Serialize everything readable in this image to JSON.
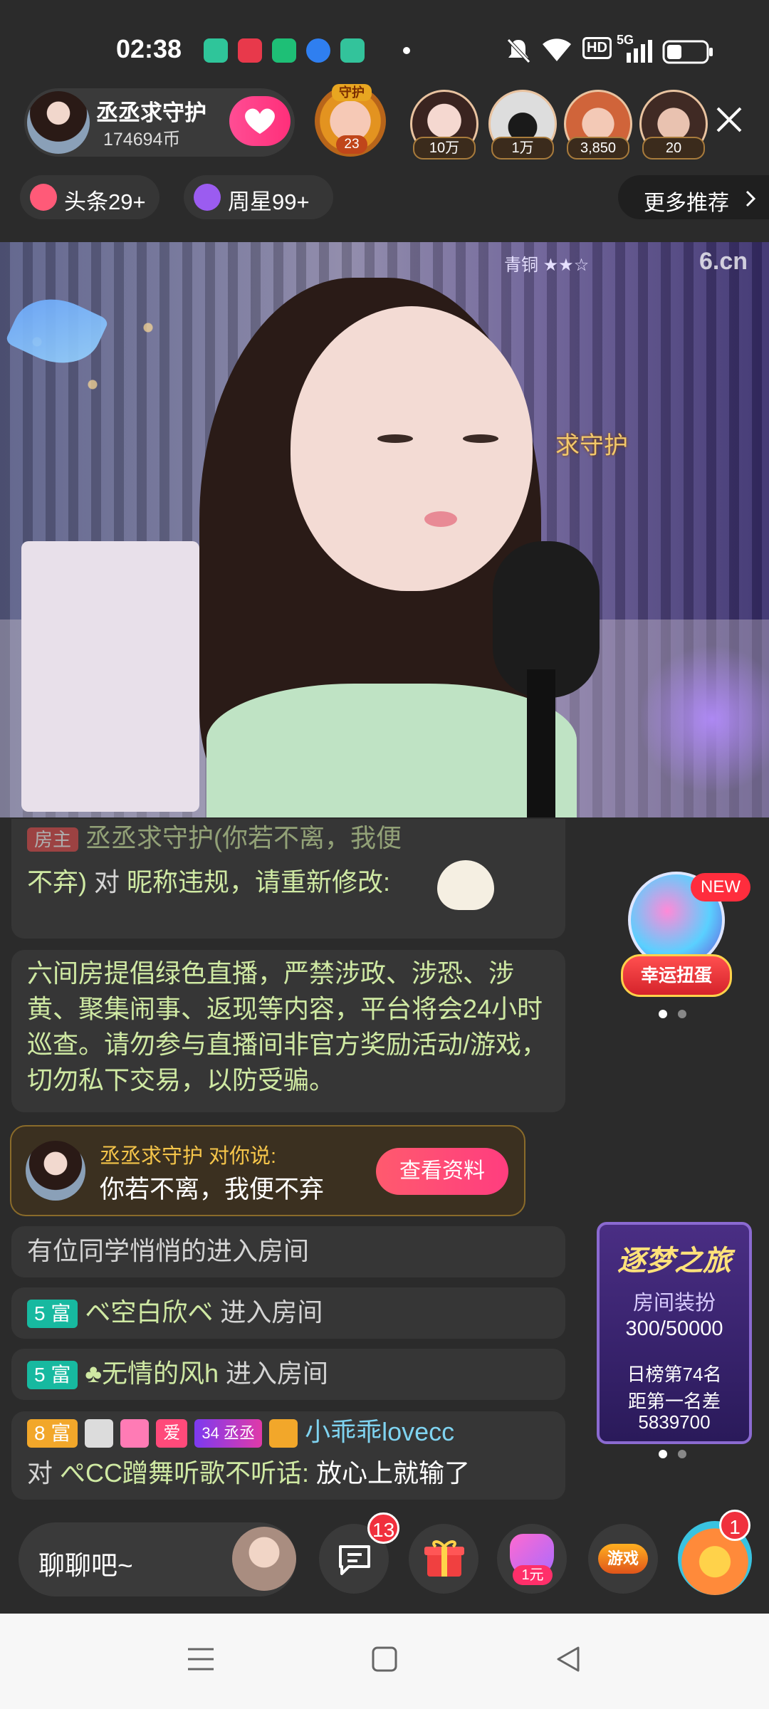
{
  "status_bar": {
    "time": "02:38",
    "network": "5G",
    "hd": "HD"
  },
  "header": {
    "anchor_name": "丞丞求守护",
    "anchor_coins": "174694币",
    "guard_label": "守护",
    "guard_count": "23",
    "viewers": [
      {
        "count": "10万"
      },
      {
        "count": "1万"
      },
      {
        "count": "3,850"
      },
      {
        "count": "20"
      }
    ]
  },
  "chips": {
    "headline": "头条29+",
    "week_star": "周星99+",
    "more_recommend": "更多推荐"
  },
  "video": {
    "rank_badge": "青铜 ★★☆",
    "logo": "6.cn",
    "overlay_text": "求守护"
  },
  "chat": {
    "msg1_cut": "丞丞求守护(你若不离，我便",
    "msg1_role": "房主",
    "msg1_tail": "不弃)",
    "msg1_to": "对",
    "msg1_body": "昵称违规，请重新修改:",
    "notice": "六间房提倡绿色直播，严禁涉政、涉恐、涉黄、聚集闹事、返现等内容，平台将会24小时巡查。请勿参与直播间非官方奖励活动/游戏，切勿私下交易，以防受骗。",
    "private_from": "丞丞求守护 对你说:",
    "private_text": "你若不离，我便不弃",
    "view_profile": "查看资料",
    "enter1": "有位同学悄悄的进入房间",
    "enter2_level": "5 富",
    "enter2_name": "ベ空白欣ベ",
    "enter2_action": "进入房间",
    "enter3_level": "5 富",
    "enter3_name": "♣无情的风h",
    "enter3_action": "进入房间",
    "msg5_level": "8 富",
    "msg5_badge_ai": "爱",
    "msg5_badge_num": "34",
    "msg5_badge_name": "丞丞",
    "msg5_name": "小乖乖lovecc",
    "msg5_to": "对",
    "msg5_target": "ぺCC蹭舞听歌不听话:",
    "msg5_body": "放心上就输了"
  },
  "side": {
    "gacha_new": "NEW",
    "gacha_label": "幸运扭蛋",
    "journey_title": "逐梦之旅",
    "journey_sub": "房间装扮",
    "journey_progress": "300/50000",
    "journey_rank": "日榜第74名",
    "journey_gap_label": "距第一名差",
    "journey_gap_value": "5839700"
  },
  "bottom": {
    "chat_placeholder": "聊聊吧~",
    "messages_badge": "13",
    "one_yuan_label": "1元",
    "game_label": "游戏",
    "mascot_badge": "1"
  },
  "colors": {
    "background": "#2b2b2b",
    "accent_pink": "#ff2f7a",
    "chat_green": "#cfe9a3",
    "badge_red": "#f0303d"
  }
}
